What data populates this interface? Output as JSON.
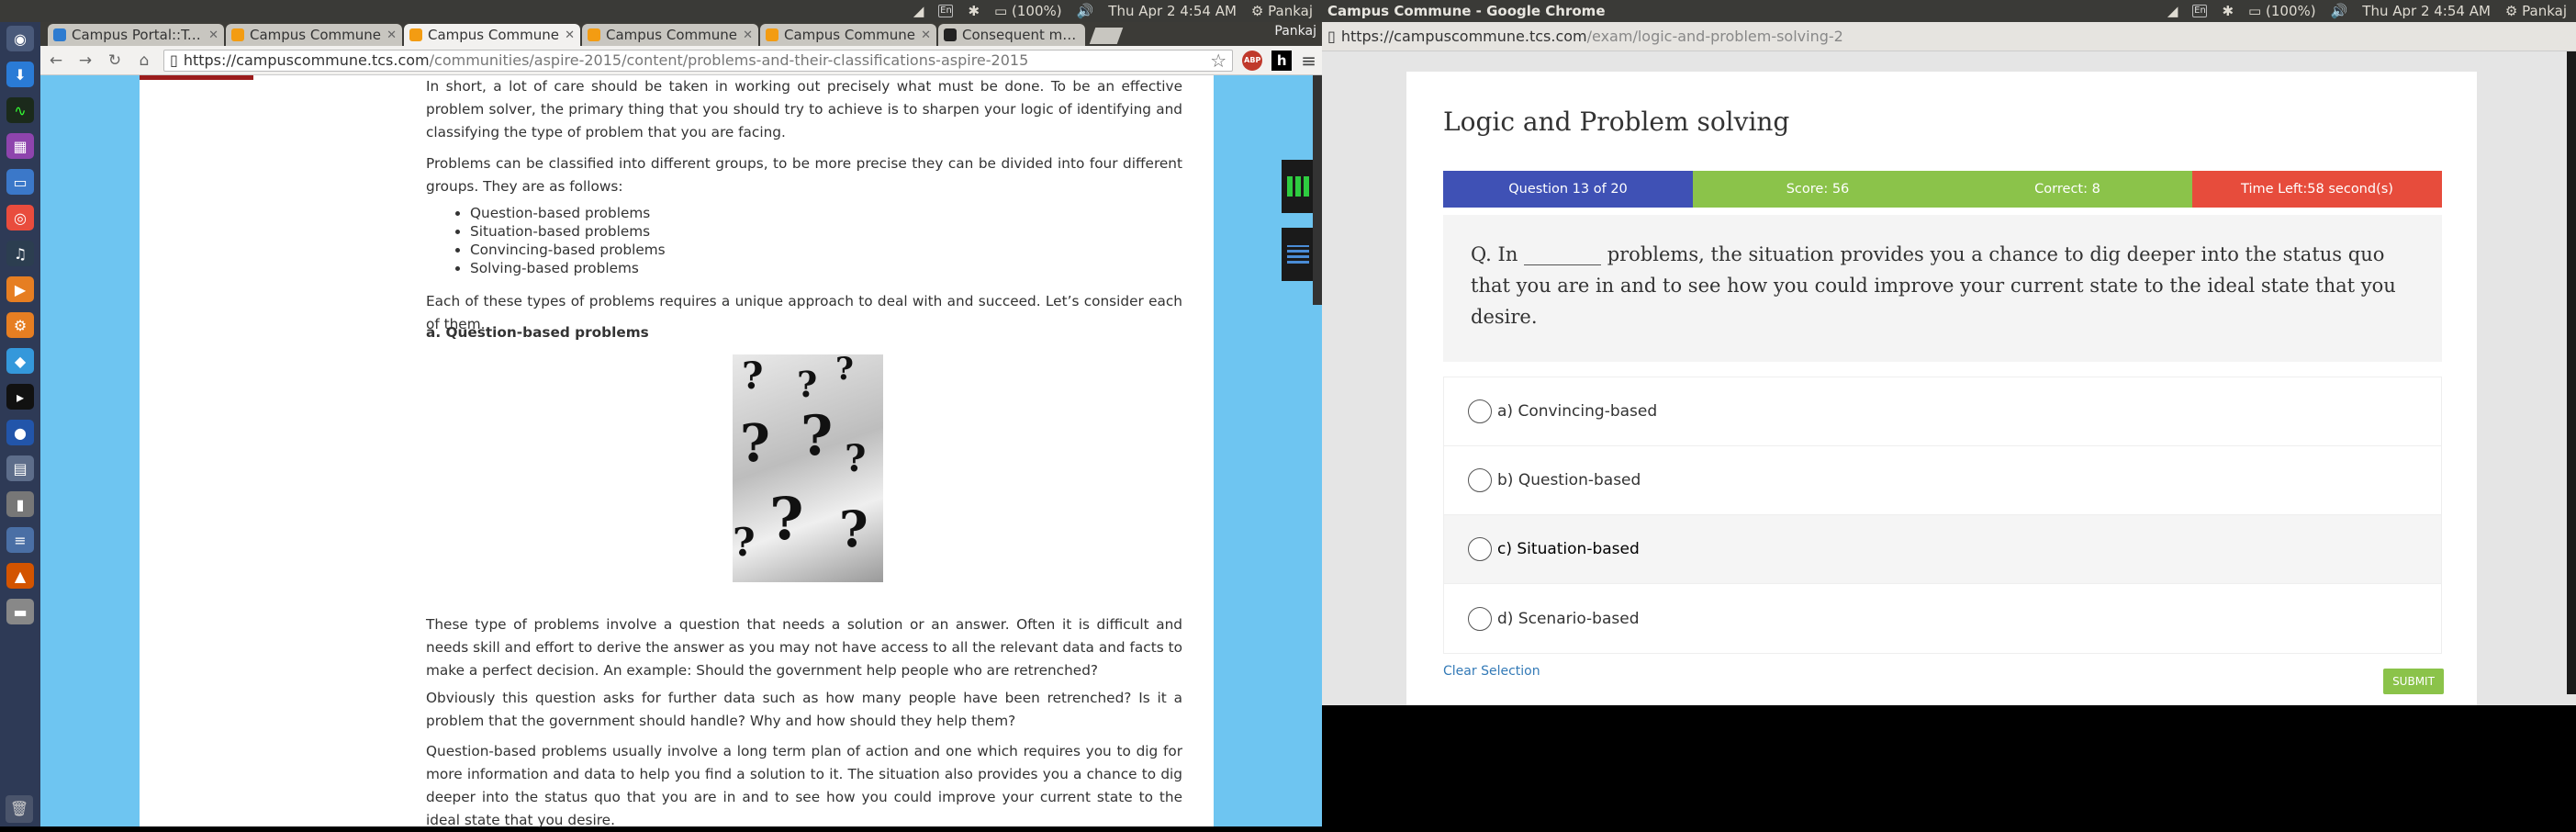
{
  "topbar_left": {
    "keyboard": "En",
    "battery": "(100%)",
    "datetime": "Thu Apr  2  4:54 AM",
    "user": "Pankaj"
  },
  "topbar_right": {
    "window_title": "Campus Commune - Google Chrome",
    "keyboard": "En",
    "battery": "(100%)",
    "datetime": "Thu Apr  2  4:54 AM",
    "user": "Pankaj"
  },
  "left_browser": {
    "tabs": [
      {
        "label": "Campus Portal::Tata"
      },
      {
        "label": "Campus Commune"
      },
      {
        "label": "Campus Commune"
      },
      {
        "label": "Campus Commune"
      },
      {
        "label": "Campus Commune"
      },
      {
        "label": "Consequent meanin"
      }
    ],
    "profile": "Pankaj",
    "url_host": "https://campuscommune.tcs.com",
    "url_path": "/communities/aspire-2015/content/problems-and-their-classifications-aspire-2015",
    "abp": "ABP",
    "hico": "h"
  },
  "article": {
    "p1": "In short, a lot of care should be taken in working out precisely what must be done. To be an effective problem solver, the primary thing that you should try to achieve is to sharpen your logic of identifying and classifying the type of problem that you are facing.",
    "p2": "Problems can be classified into different groups, to be more precise they can be divided into four different groups. They are as follows:",
    "list": [
      "Question-based problems",
      "Situation-based problems",
      "Convincing-based problems",
      "Solving-based problems"
    ],
    "p3": "Each of these types of problems requires a unique approach to deal with and succeed. Let’s consider each of them.",
    "heading": "a. Question-based problems",
    "p4": "These type of problems involve a question that needs a solution or an answer. Often it is difficult and needs skill and effort to derive the answer as you may not have access to all the relevant data and facts to make a perfect decision. An example: Should the government help people who are retrenched?",
    "p5": "Obviously this question asks for further data such as how many people have been retrenched? Is it a problem that the government should handle? Why and how should they help them?",
    "p6": "Question-based problems usually involve a long term plan of action and one which requires you to dig for more information and data to help you find a solution to it. The situation also provides you a chance to dig deeper into the status quo that you are in and to see how you could improve your current state to the ideal state that you desire."
  },
  "right_browser": {
    "url_host": "https://campuscommune.tcs.com",
    "url_path": "/exam/logic-and-problem-solving-2"
  },
  "exam": {
    "title": "Logic and Problem solving",
    "question_no": "Question 13 of 20",
    "score": "Score: 56",
    "correct": "Correct: 8",
    "time_left": "Time Left:58 second(s)",
    "question": "Q. In ________ problems, the situation provides you a chance to dig deeper into the status quo that you are in and to see how you could improve your current state to the ideal state that you desire.",
    "options": [
      {
        "label": "a) Convincing-based"
      },
      {
        "label": "b) Question-based"
      },
      {
        "label": "c) Situation-based"
      },
      {
        "label": "d) Scenario-based"
      }
    ],
    "clear": "Clear Selection",
    "submit": "SUBMIT",
    "colors": {
      "question": "#3f51b5",
      "score": "#8bc34a",
      "correct": "#8bc34a",
      "time": "#e74c3c"
    }
  }
}
